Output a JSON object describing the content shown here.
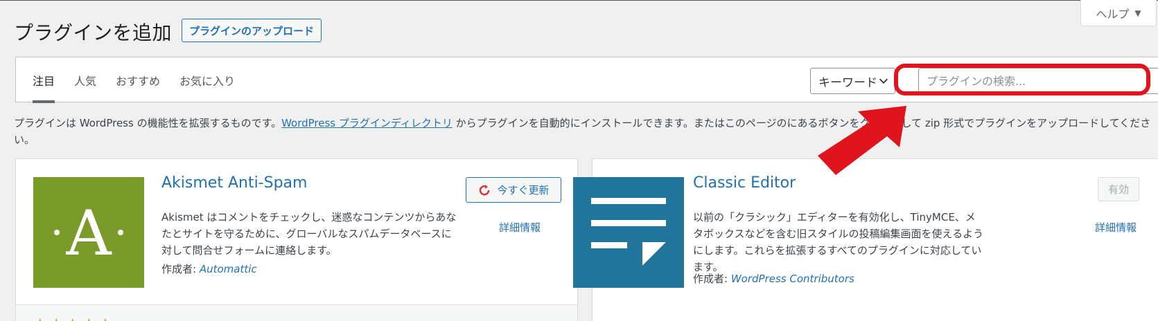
{
  "header": {
    "title": "プラグインを追加",
    "upload_button": "プラグインのアップロード",
    "help_label": "ヘルプ"
  },
  "filter": {
    "tabs": [
      {
        "label": "注目",
        "active": true
      },
      {
        "label": "人気",
        "active": false
      },
      {
        "label": "おすすめ",
        "active": false
      },
      {
        "label": "お気に入り",
        "active": false
      }
    ],
    "search_type": "キーワード",
    "search_placeholder": "プラグインの検索..."
  },
  "intro": {
    "text_before": "プラグインは WordPress の機能性を拡張するものです。",
    "link_text": "WordPress プラグインディレクトリ",
    "text_mid": " からプラグインを自動的にインストールできます。またはこのページの",
    "text_after": "にあるボタンをクリックして zip 形式でプラグインをアップロードしてください。"
  },
  "plugins": [
    {
      "name": "Akismet Anti-Spam",
      "description": "Akismet はコメントをチェックし、迷惑なコンテンツからあなたとサイトを守るために、グローバルなスパムデータベースに対して問合せフォームに連絡します。",
      "author_label": "作成者: ",
      "author": "Automattic",
      "action_label": "今すぐ更新",
      "details_label": "詳細情報",
      "icon_letter": "·A·",
      "icon_color": "#7a9a2a",
      "icon": "akismet-logo"
    },
    {
      "name": "Classic Editor",
      "description": "以前の「クラシック」エディターを有効化し、TinyMCE、メタボックスなどを含む旧スタイルの投稿編集画面を使えるようにします。これらを拡張するすべてのプラグインに対応しています。",
      "author_label": "作成者: ",
      "author": "WordPress Contributors",
      "action_label": "有効",
      "details_label": "詳細情報",
      "icon_color": "#21759b",
      "icon": "document-icon"
    }
  ],
  "colors": {
    "accent": "#2271b1",
    "highlight": "#e0141c",
    "background": "#f0f0f1"
  }
}
